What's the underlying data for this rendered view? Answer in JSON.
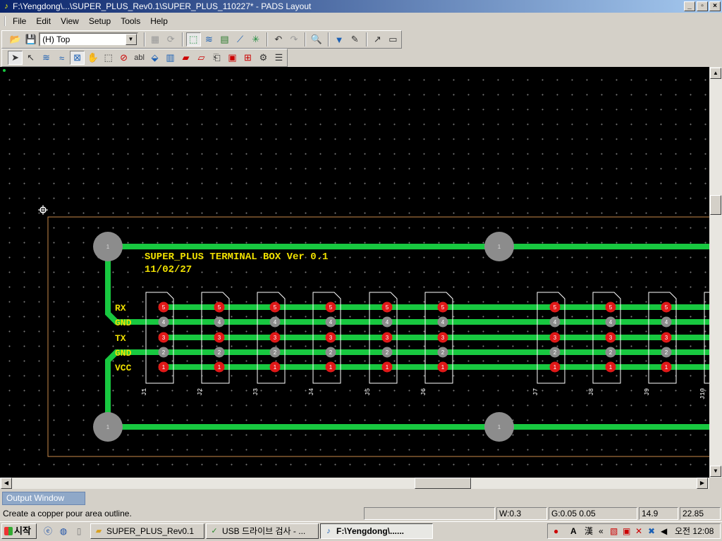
{
  "window": {
    "title": "F:\\Yengdong\\...\\SUPER_PLUS_Rev0.1\\SUPER_PLUS_110227* - PADS Layout",
    "controls": [
      "_",
      "▫",
      "×"
    ]
  },
  "menu": [
    "File",
    "Edit",
    "View",
    "Setup",
    "Tools",
    "Help"
  ],
  "toolbar": {
    "layer_value": "(H) Top"
  },
  "board": {
    "title_line1": "SUPER_PLUS TERMINAL BOX Ver 0.1",
    "title_line2": "11/02/27",
    "net_labels": [
      "RX",
      "GND",
      "TX",
      "GND",
      "VCC"
    ],
    "pin_numbers": [
      "5",
      "4",
      "3",
      "2",
      "1"
    ],
    "mount_hole_label": "1",
    "connectors": [
      "J1",
      "J2",
      "J3",
      "J4",
      "J5",
      "J6",
      "J7",
      "J8",
      "J9",
      "J10"
    ],
    "colors": {
      "background": "#000000",
      "trace": "#18c840",
      "outline": "#c88a4a",
      "text": "#f0e000",
      "pad_red": "#e01818",
      "pad_gray": "#8c8c8c",
      "outline_white": "#ffffff"
    }
  },
  "output_window": {
    "tab_label": "Output Window"
  },
  "status": {
    "message": "Create a copper pour area outline.",
    "width": "W:0.3",
    "grid": "G:0.05 0.05",
    "x": "14.9",
    "y": "22.85"
  },
  "taskbar": {
    "start_label": "시작",
    "tasks": [
      {
        "label": "SUPER_PLUS_Rev0.1",
        "active": false
      },
      {
        "label": "USB 드라이브 검사 - ...",
        "active": false
      },
      {
        "label": "F:\\Yengdong\\......",
        "active": true
      }
    ],
    "tray_chevron": "«",
    "ime_label": "A",
    "clock": "오전 12:08"
  }
}
